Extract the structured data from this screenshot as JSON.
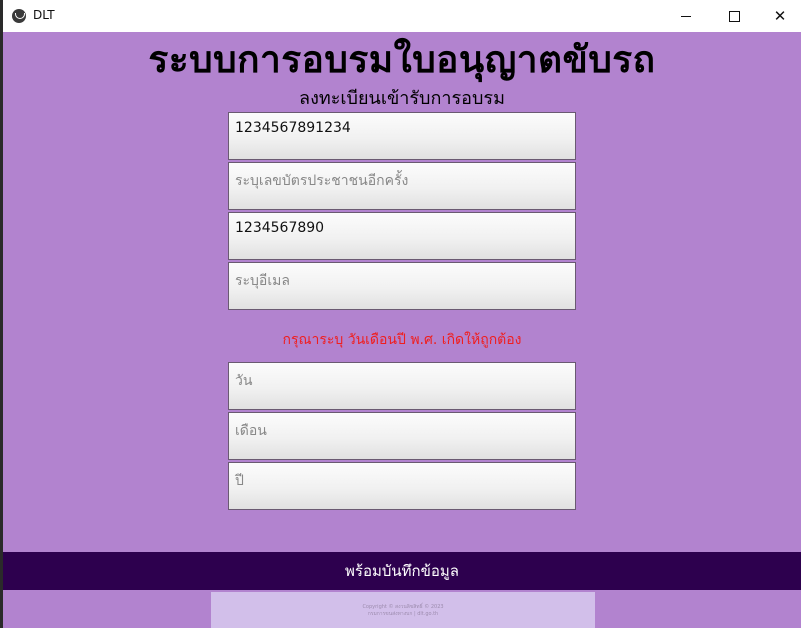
{
  "window": {
    "title": "DLT",
    "minimize_glyph": "minimize-icon",
    "maximize_glyph": "maximize-icon",
    "close_glyph": "✕"
  },
  "header": {
    "title": "ระบบการอบรมใบอนุญาตขับรถ",
    "subtitle": "ลงทะเบียนเข้ารับการอบรม"
  },
  "form": {
    "id_value": "1234567891234",
    "id_confirm_placeholder": "ระบุเลขบัตรประชาชนอีกครั้ง",
    "phone_value": "1234567890",
    "email_placeholder": "ระบุอีเมล",
    "warning": "กรุณาระบุ วันเดือนปี พ.ศ. เกิดให้ถูกต้อง",
    "day_placeholder": "วัน",
    "month_placeholder": "เดือน",
    "year_placeholder": "ปี"
  },
  "submit_label": "พร้อมบันทึกข้อมูล",
  "footer": {
    "line1": "Copyright © สงวนลิขสิทธิ์ © 2023",
    "line2": "กรมการขนส่งทางบก | dlt.go.th"
  },
  "colors": {
    "background": "#b283cf",
    "submit_bar": "#2d004e",
    "warning_text": "#f01e1e"
  }
}
